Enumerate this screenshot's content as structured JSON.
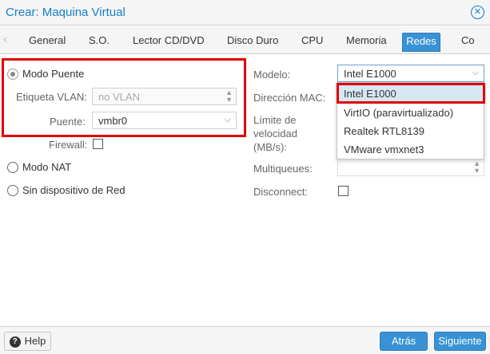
{
  "window": {
    "title": "Crear: Maquina Virtual"
  },
  "tabs": [
    "General",
    "S.O.",
    "Lector CD/DVD",
    "Disco Duro",
    "CPU",
    "Memoria",
    "Redes",
    "Co"
  ],
  "active_tab": "Redes",
  "left": {
    "bridge_mode_label": "Modo Puente",
    "vlan_label": "Etiqueta VLAN:",
    "vlan_placeholder": "no VLAN",
    "bridge_label": "Puente:",
    "bridge_value": "vmbr0",
    "firewall_label": "Firewall:",
    "nat_mode_label": "Modo NAT",
    "no_device_label": "Sin dispositivo de Red"
  },
  "right": {
    "model_label": "Modelo:",
    "model_value": "Intel E1000",
    "mac_label": "Dirección MAC:",
    "rate_label_1": "Límite de",
    "rate_label_2": "velocidad",
    "rate_label_3": "(MB/s):",
    "multiqueues_label": "Multiqueues:",
    "disconnect_label": "Disconnect:"
  },
  "dropdown": {
    "options": [
      "Intel E1000",
      "VirtIO (paravirtualizado)",
      "Realtek RTL8139",
      "VMware vmxnet3"
    ],
    "selected_index": 0
  },
  "footer": {
    "help_label": "Help",
    "back_label": "Atrás",
    "next_label": "Siguiente"
  },
  "colors": {
    "accent": "#157fcc",
    "highlight": "#e00000",
    "button": "#3892d4"
  }
}
